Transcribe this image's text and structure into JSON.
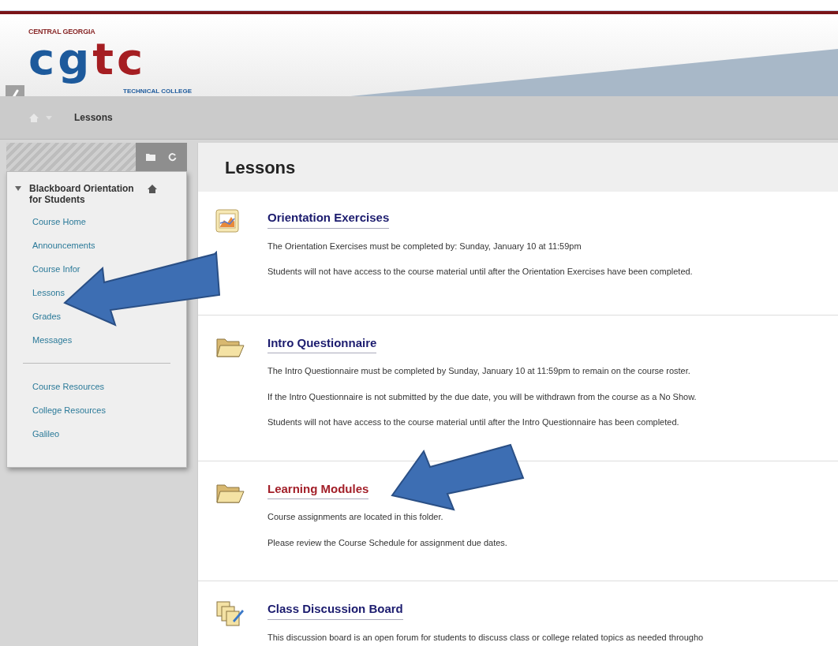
{
  "logo": {
    "top_text": "CENTRAL GEORGIA",
    "letters_blue": "cg",
    "letters_red": "tc",
    "bottom_text": "TECHNICAL COLLEGE"
  },
  "breadcrumb": {
    "current": "Lessons"
  },
  "course_menu": {
    "title": "Blackboard Orientation for Students",
    "expanded": true,
    "items": [
      {
        "label": "Course Home"
      },
      {
        "label": "Announcements"
      },
      {
        "label": "Course Infor"
      },
      {
        "label": "Lessons"
      },
      {
        "label": "Grades"
      },
      {
        "label": "Messages"
      }
    ],
    "items_2": [
      {
        "label": "Course Resources"
      },
      {
        "label": "College Resources"
      },
      {
        "label": "Galileo"
      }
    ]
  },
  "page": {
    "title": "Lessons",
    "items": [
      {
        "kind": "exercise",
        "title": "Orientation Exercises",
        "highlighted": false,
        "lines": [
          "The Orientation Exercises must be completed by: Sunday, January 10 at 11:59pm",
          "Students will not have access to the course material until after the Orientation Exercises have been completed."
        ]
      },
      {
        "kind": "folder",
        "title": "Intro Questionnaire",
        "highlighted": false,
        "lines": [
          "The Intro Questionnaire must be completed by Sunday, January 10 at 11:59pm to remain on the course roster.",
          "If the Intro Questionnaire is not submitted by the due date, you will be withdrawn from the course as a No Show.",
          "Students will not have access to the course material until after the Intro Questionnaire has been completed."
        ]
      },
      {
        "kind": "folder",
        "title": "Learning Modules",
        "highlighted": true,
        "lines": [
          "Course assignments are located in this folder.",
          "Please review the Course Schedule for assignment due dates."
        ]
      },
      {
        "kind": "discussion",
        "title": "Class Discussion Board",
        "highlighted": false,
        "lines": [
          "This discussion board is an open forum for students to discuss class or college related topics as needed througho"
        ]
      }
    ]
  }
}
